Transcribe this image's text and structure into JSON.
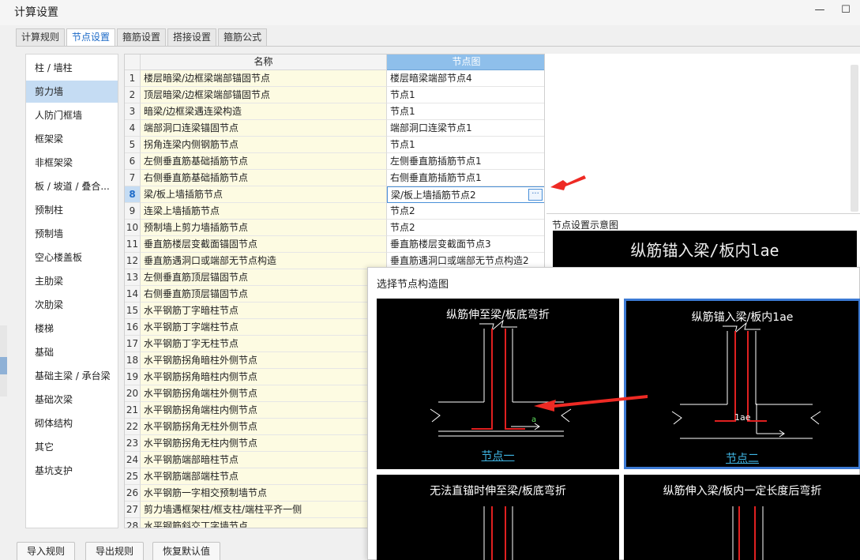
{
  "window": {
    "title": "计算设置",
    "minimize": "—",
    "maximize": "☐"
  },
  "tabs": [
    {
      "label": "计算规则",
      "active": false
    },
    {
      "label": "节点设置",
      "active": true
    },
    {
      "label": "箍筋设置",
      "active": false
    },
    {
      "label": "搭接设置",
      "active": false
    },
    {
      "label": "箍筋公式",
      "active": false
    }
  ],
  "categories": [
    {
      "label": "柱 / 墙柱",
      "selected": false
    },
    {
      "label": "剪力墙",
      "selected": true
    },
    {
      "label": "人防门框墙",
      "selected": false
    },
    {
      "label": "框架梁",
      "selected": false
    },
    {
      "label": "非框架梁",
      "selected": false
    },
    {
      "label": "板 / 坡道 / 叠合...",
      "selected": false
    },
    {
      "label": "预制柱",
      "selected": false
    },
    {
      "label": "预制墙",
      "selected": false
    },
    {
      "label": "空心楼盖板",
      "selected": false
    },
    {
      "label": "主肋梁",
      "selected": false
    },
    {
      "label": "次肋梁",
      "selected": false
    },
    {
      "label": "楼梯",
      "selected": false
    },
    {
      "label": "基础",
      "selected": false
    },
    {
      "label": "基础主梁 / 承台梁",
      "selected": false
    },
    {
      "label": "基础次梁",
      "selected": false
    },
    {
      "label": "砌体结构",
      "selected": false
    },
    {
      "label": "其它",
      "selected": false
    },
    {
      "label": "基坑支护",
      "selected": false
    }
  ],
  "grid": {
    "columns": {
      "name": "名称",
      "node": "节点图"
    },
    "rows": [
      {
        "num": "1",
        "name": "楼层暗梁/边框梁端部锚固节点",
        "node": "楼层暗梁端部节点4"
      },
      {
        "num": "2",
        "name": "顶层暗梁/边框梁端部锚固节点",
        "node": "节点1"
      },
      {
        "num": "3",
        "name": "暗梁/边框梁遇连梁构造",
        "node": "节点1"
      },
      {
        "num": "4",
        "name": "端部洞口连梁锚固节点",
        "node": "端部洞口连梁节点1"
      },
      {
        "num": "5",
        "name": "拐角连梁内侧钢筋节点",
        "node": "节点1"
      },
      {
        "num": "6",
        "name": "左侧垂直筋基础插筋节点",
        "node": "左侧垂直筋插筋节点1"
      },
      {
        "num": "7",
        "name": "右侧垂直筋基础插筋节点",
        "node": "右侧垂直筋插筋节点1"
      },
      {
        "num": "8",
        "name": "梁/板上墙插筋节点",
        "node": "梁/板上墙插筋节点2",
        "selected": true
      },
      {
        "num": "9",
        "name": "连梁上墙插筋节点",
        "node": "节点2"
      },
      {
        "num": "10",
        "name": "预制墙上剪力墙插筋节点",
        "node": "节点2"
      },
      {
        "num": "11",
        "name": "垂直筋楼层变截面锚固节点",
        "node": "垂直筋楼层变截面节点3"
      },
      {
        "num": "12",
        "name": "垂直筋遇洞口或端部无节点构造",
        "node": "垂直筋遇洞口或端部无节点构造2"
      },
      {
        "num": "13",
        "name": "左侧垂直筋顶层锚固节点",
        "node": ""
      },
      {
        "num": "14",
        "name": "右侧垂直筋顶层锚固节点",
        "node": ""
      },
      {
        "num": "15",
        "name": "水平钢筋丁字暗柱节点",
        "node": ""
      },
      {
        "num": "16",
        "name": "水平钢筋丁字端柱节点",
        "node": ""
      },
      {
        "num": "17",
        "name": "水平钢筋丁字无柱节点",
        "node": ""
      },
      {
        "num": "18",
        "name": "水平钢筋拐角暗柱外侧节点",
        "node": ""
      },
      {
        "num": "19",
        "name": "水平钢筋拐角暗柱内侧节点",
        "node": ""
      },
      {
        "num": "20",
        "name": "水平钢筋拐角端柱外侧节点",
        "node": ""
      },
      {
        "num": "21",
        "name": "水平钢筋拐角端柱内侧节点",
        "node": ""
      },
      {
        "num": "22",
        "name": "水平钢筋拐角无柱外侧节点",
        "node": ""
      },
      {
        "num": "23",
        "name": "水平钢筋拐角无柱内侧节点",
        "node": ""
      },
      {
        "num": "24",
        "name": "水平钢筋端部暗柱节点",
        "node": ""
      },
      {
        "num": "25",
        "name": "水平钢筋端部端柱节点",
        "node": ""
      },
      {
        "num": "26",
        "name": "水平钢筋一字相交预制墙节点",
        "node": ""
      },
      {
        "num": "27",
        "name": "剪力墙遇框架柱/框支柱/端柱平齐一侧",
        "node": ""
      },
      {
        "num": "28",
        "name": "水平钢筋斜交丁字墙节点",
        "node": ""
      }
    ],
    "ellipsis": "···"
  },
  "preview": {
    "title": "节点设置示意图",
    "caption": "纵筋锚入梁/板内lae"
  },
  "popup": {
    "title": "选择节点构造图",
    "cards": [
      {
        "title": "纵筋伸至梁/板底弯折",
        "link": "节点一",
        "mark": "a"
      },
      {
        "title": "纵筋锚入梁/板内1ae",
        "link": "节点二",
        "mark": "1ae",
        "selected": true
      },
      {
        "title": "无法直锚时伸至梁/板底弯折",
        "link": ""
      },
      {
        "title": "纵筋伸入梁/板内一定长度后弯折",
        "link": ""
      }
    ]
  },
  "buttons": {
    "import": "导入规则",
    "export": "导出规则",
    "reset": "恢复默认值"
  },
  "colors": {
    "accent": "#4a90d9",
    "header_selected": "#8ebfeb",
    "rebar_red": "#e02020",
    "annotation_red": "#ee2a24",
    "link_cyan": "#3fb7e6"
  }
}
